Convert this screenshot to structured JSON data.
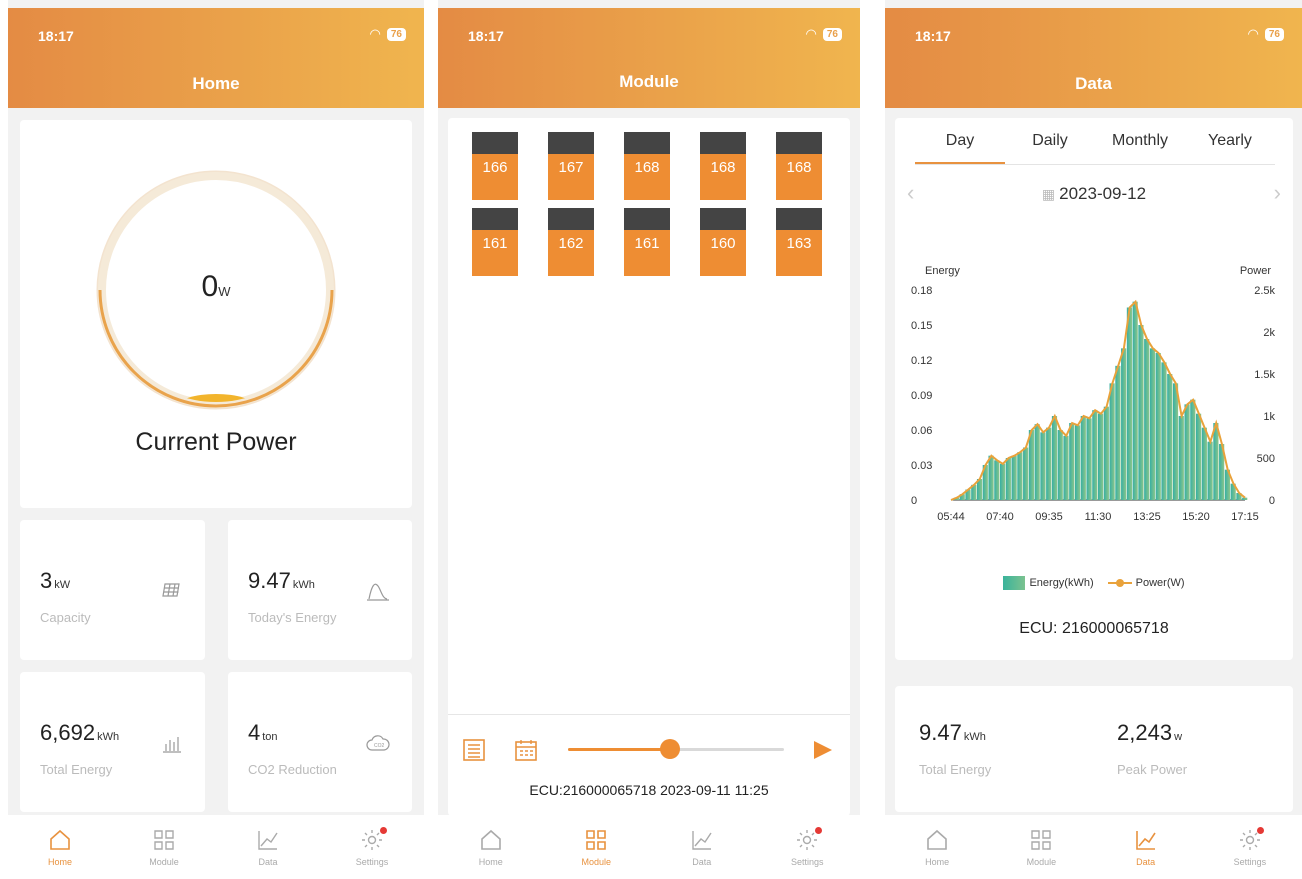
{
  "status": {
    "time": "18:17",
    "battery": "76"
  },
  "tabbar": [
    "Home",
    "Module",
    "Data",
    "Settings"
  ],
  "home": {
    "title": "Home",
    "power_value": "0",
    "power_unit": "W",
    "power_label": "Current Power",
    "stats": [
      {
        "value": "3",
        "unit": "kW",
        "label": "Capacity"
      },
      {
        "value": "9.47",
        "unit": "kWh",
        "label": "Today's Energy"
      },
      {
        "value": "6,692",
        "unit": "kWh",
        "label": "Total Energy"
      },
      {
        "value": "4",
        "unit": "ton",
        "label": "CO2 Reduction"
      }
    ]
  },
  "module": {
    "title": "Module",
    "rows": [
      [
        "166",
        "167",
        "168",
        "168",
        "168"
      ],
      [
        "161",
        "162",
        "161",
        "160",
        "163"
      ]
    ],
    "footer": "ECU:216000065718 2023-09-11 11:25",
    "slider_position": 0.47
  },
  "data": {
    "title": "Data",
    "tabs": [
      "Day",
      "Daily",
      "Monthly",
      "Yearly"
    ],
    "date": "2023-09-12",
    "ecu": "ECU:  216000065718",
    "summary": [
      {
        "value": "9.47",
        "unit": "kWh",
        "label": "Total Energy"
      },
      {
        "value": "2,243",
        "unit": "w",
        "label": "Peak Power"
      }
    ]
  },
  "chart_data": {
    "type": "area",
    "ylabel_left": "Energy",
    "ylabel_right": "Power",
    "y_ticks_left": [
      "0.18",
      "0.15",
      "0.12",
      "0.09",
      "0.06",
      "0.03",
      "0"
    ],
    "y_ticks_right": [
      "2.5k",
      "2k",
      "1.5k",
      "1k",
      "500",
      "0"
    ],
    "x_ticks": [
      "05:44",
      "07:40",
      "09:35",
      "11:30",
      "13:25",
      "15:20",
      "17:15"
    ],
    "legend": [
      "Energy(kWh)",
      "Power(W)"
    ],
    "ylim_left": [
      0,
      0.18
    ],
    "ylim_right": [
      0,
      2500
    ],
    "series": [
      {
        "name": "Energy(kWh)",
        "color": "#3ab39b",
        "values": [
          0,
          0.002,
          0.005,
          0.009,
          0.013,
          0.018,
          0.03,
          0.038,
          0.034,
          0.031,
          0.036,
          0.038,
          0.041,
          0.045,
          0.06,
          0.065,
          0.058,
          0.062,
          0.072,
          0.06,
          0.055,
          0.066,
          0.064,
          0.072,
          0.07,
          0.077,
          0.074,
          0.08,
          0.1,
          0.115,
          0.13,
          0.165,
          0.17,
          0.15,
          0.138,
          0.13,
          0.126,
          0.118,
          0.108,
          0.1,
          0.072,
          0.082,
          0.086,
          0.074,
          0.062,
          0.05,
          0.066,
          0.048,
          0.026,
          0.014,
          0.006,
          0.002
        ]
      },
      {
        "name": "Power(W)",
        "color": "#e9a23b"
      }
    ]
  }
}
